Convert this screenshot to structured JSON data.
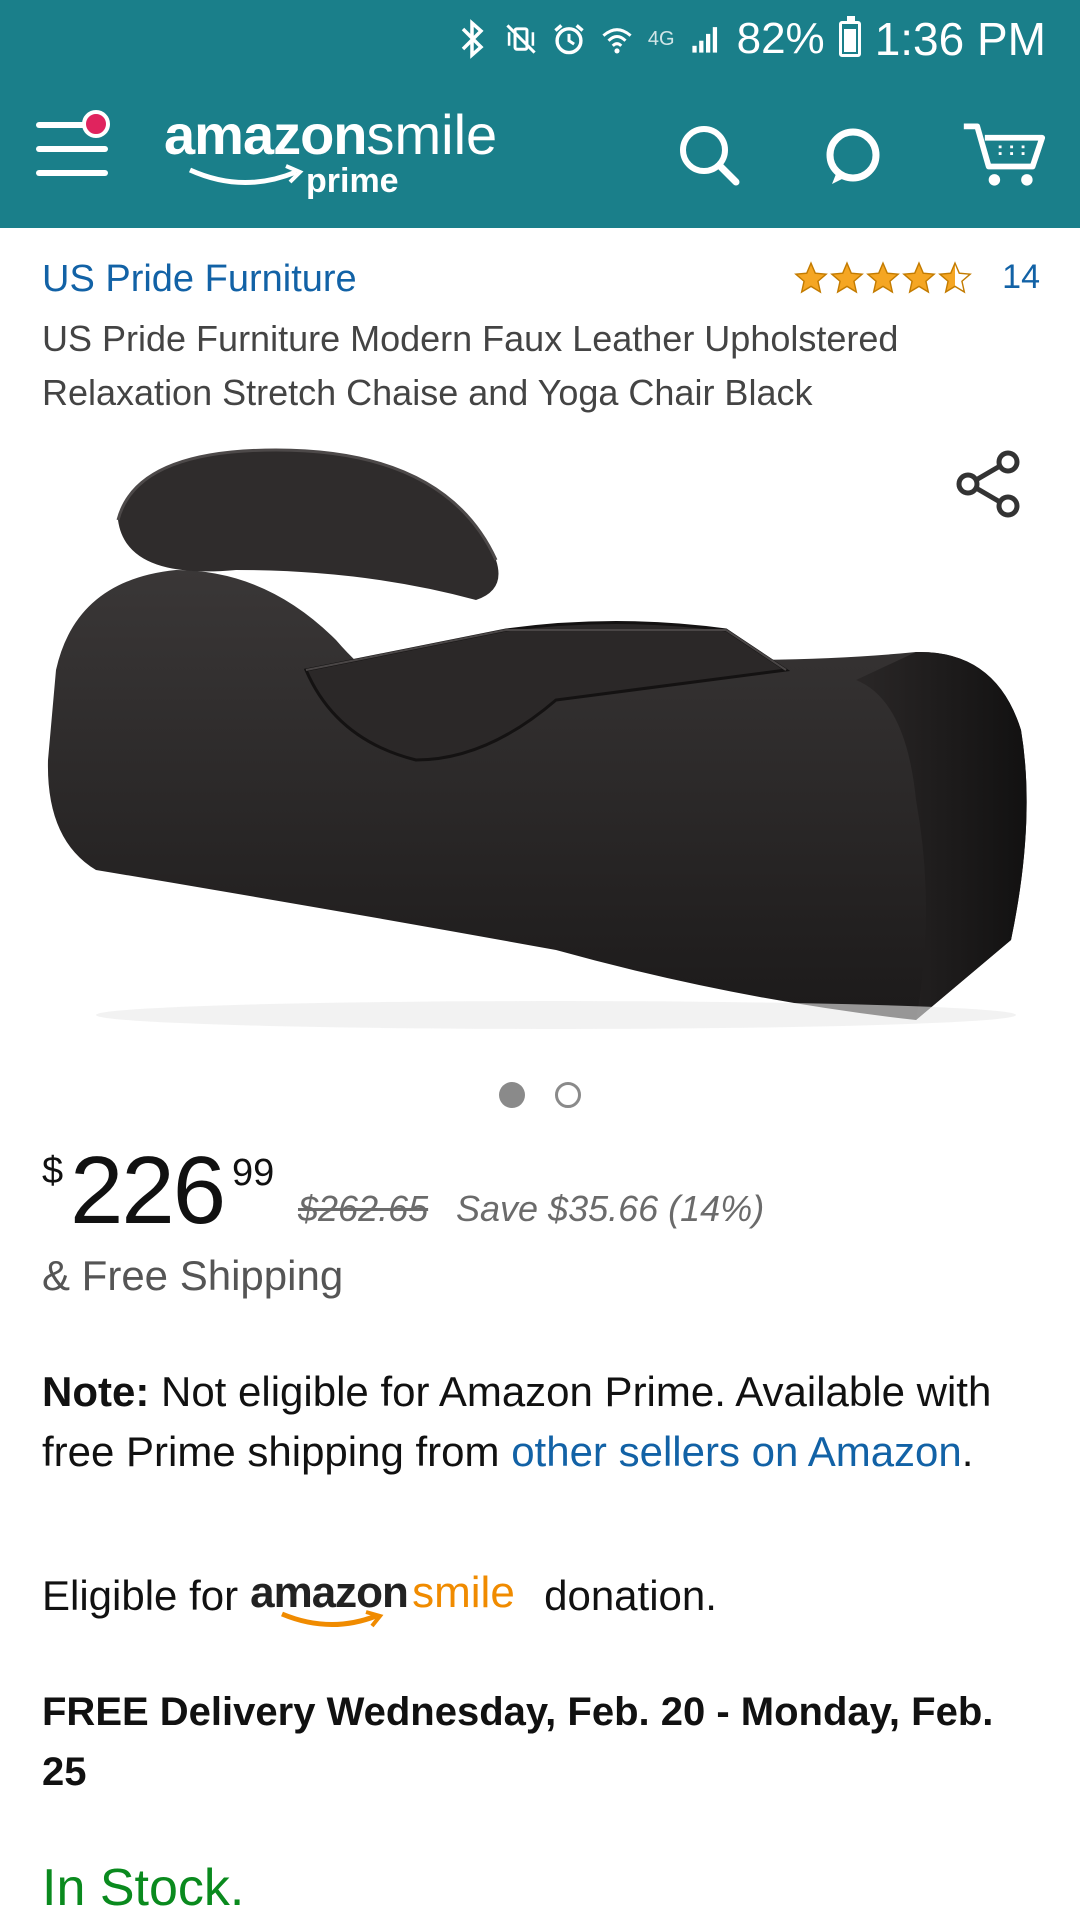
{
  "status_bar": {
    "battery": "82%",
    "time": "1:36 PM",
    "network": "4G"
  },
  "header": {
    "logo_word1": "amazon",
    "logo_word2": "smile",
    "logo_sub": "prime",
    "colors": {
      "bar": "#1a7f8a",
      "notification_dot": "#e0245e"
    }
  },
  "product": {
    "brand": "US Pride Furniture",
    "rating_stars": 4.5,
    "rating_count": "14",
    "title": "US Pride Furniture Modern Faux Leather Upholstered Relaxation Stretch Chaise and Yoga Chair Black",
    "image_index": 1,
    "image_total": 2
  },
  "pricing": {
    "currency": "$",
    "whole": "226",
    "cents": "99",
    "list_price": "$262.65",
    "savings": "Save $35.66 (14%)",
    "shipping": "& Free Shipping"
  },
  "note": {
    "label": "Note:",
    "text": " Not eligible for Amazon Prime. Available with free Prime shipping from ",
    "link": "other sellers on Amazon",
    "end": "."
  },
  "smile_eligibility": {
    "prefix": "Eligible for",
    "logo_a": "amazon",
    "logo_b": "smile",
    "suffix": "donation."
  },
  "delivery": "FREE Delivery Wednesday, Feb. 20 - Monday, Feb. 25",
  "stock": "In Stock."
}
